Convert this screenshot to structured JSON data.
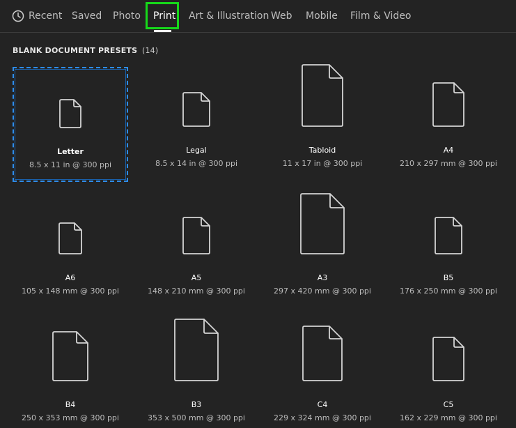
{
  "tabs": [
    {
      "label": "Recent",
      "icon": "clock-icon"
    },
    {
      "label": "Saved"
    },
    {
      "label": "Photo"
    },
    {
      "label": "Print",
      "active": true
    },
    {
      "label": "Art & Illustration"
    },
    {
      "label": "Web"
    },
    {
      "label": "Mobile"
    },
    {
      "label": "Film & Video"
    }
  ],
  "section": {
    "title": "BLANK DOCUMENT PRESETS",
    "count": "(14)"
  },
  "presets": [
    {
      "name": "Letter",
      "dims": "8.5 x 11 in @ 300 ppi",
      "selected": true
    },
    {
      "name": "Legal",
      "dims": "8.5 x 14 in @ 300 ppi"
    },
    {
      "name": "Tabloid",
      "dims": "11 x 17 in @ 300 ppi"
    },
    {
      "name": "A4",
      "dims": "210 x 297 mm @ 300 ppi"
    },
    {
      "name": "A6",
      "dims": "105 x 148 mm @ 300 ppi"
    },
    {
      "name": "A5",
      "dims": "148 x 210 mm @ 300 ppi"
    },
    {
      "name": "A3",
      "dims": "297 x 420 mm @ 300 ppi"
    },
    {
      "name": "B5",
      "dims": "176 x 250 mm @ 300 ppi"
    },
    {
      "name": "B4",
      "dims": "250 x 353 mm @ 300 ppi"
    },
    {
      "name": "B3",
      "dims": "353 x 500 mm @ 300 ppi"
    },
    {
      "name": "C4",
      "dims": "229 x 324 mm @ 300 ppi"
    },
    {
      "name": "C5",
      "dims": "162 x 229 mm @ 300 ppi"
    }
  ],
  "colors": {
    "background": "#232323",
    "selection": "#2d8ceb",
    "highlight": "#16d91a",
    "icon_stroke": "#d4d4d4"
  }
}
